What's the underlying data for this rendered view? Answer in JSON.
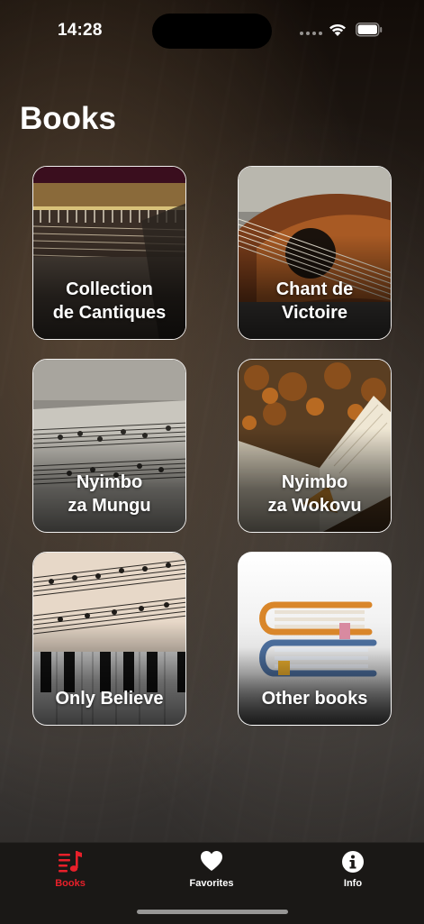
{
  "status_bar": {
    "time": "14:28"
  },
  "page": {
    "title": "Books"
  },
  "books": [
    {
      "line1": "Collection",
      "line2": "de Cantiques",
      "image": "piano-strings-image"
    },
    {
      "line1": "Chant de",
      "line2": "Victoire",
      "image": "guitar-image"
    },
    {
      "line1": "Nyimbo",
      "line2": "za Mungu",
      "image": "sheet-music-image"
    },
    {
      "line1": "Nyimbo",
      "line2": "za Wokovu",
      "image": "open-book-leaves-image"
    },
    {
      "line1": "Only Believe",
      "line2": "",
      "image": "sheet-music-piano-image"
    },
    {
      "line1": "Other books",
      "line2": "",
      "image": "book-stack-icon"
    }
  ],
  "tab_bar": {
    "tabs": [
      {
        "label": "Books",
        "icon": "music-list-icon",
        "active": true
      },
      {
        "label": "Favorites",
        "icon": "heart-icon",
        "active": false
      },
      {
        "label": "Info",
        "icon": "info-icon",
        "active": false
      }
    ],
    "active_color": "#e8202a",
    "inactive_color": "#ffffff"
  }
}
